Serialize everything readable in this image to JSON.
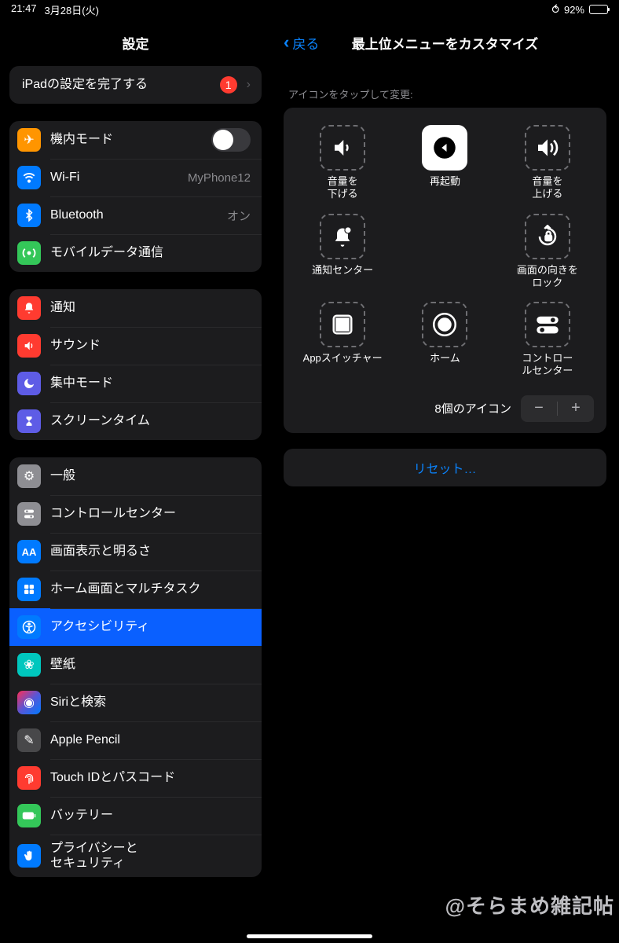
{
  "status": {
    "time": "21:47",
    "date": "3月28日(火)",
    "battery_pct": "92%"
  },
  "sidebar": {
    "title": "設定",
    "finish": {
      "label": "iPadの設定を完了する",
      "badge": "1"
    },
    "g1": {
      "airplane": "機内モード",
      "wifi": "Wi-Fi",
      "wifi_val": "MyPhone12",
      "bt": "Bluetooth",
      "bt_val": "オン",
      "cell": "モバイルデータ通信"
    },
    "g2": {
      "notif": "通知",
      "sound": "サウンド",
      "focus": "集中モード",
      "screen": "スクリーンタイム"
    },
    "g3": {
      "general": "一般",
      "cc": "コントロールセンター",
      "display": "画面表示と明るさ",
      "home": "ホーム画面とマルチタスク",
      "acc": "アクセシビリティ",
      "wall": "壁紙",
      "siri": "Siriと検索",
      "pencil": "Apple Pencil",
      "touchid": "Touch IDとパスコード",
      "battery": "バッテリー",
      "privacy": "プライバシーと\nセキュリティ"
    }
  },
  "content": {
    "back": "戻る",
    "title": "最上位メニューをカスタマイズ",
    "hint": "アイコンをタップして変更:",
    "tiles": {
      "vdown": "音量を\n下げる",
      "restart": "再起動",
      "vup": "音量を\n上げる",
      "notif": "通知センター",
      "orient": "画面の向きを\nロック",
      "appsw": "Appスイッチャー",
      "home": "ホーム",
      "cc": "コントロー\nルセンター"
    },
    "count": "8個のアイコン",
    "reset": "リセット…"
  },
  "watermark": "@そらまめ雑記帖"
}
